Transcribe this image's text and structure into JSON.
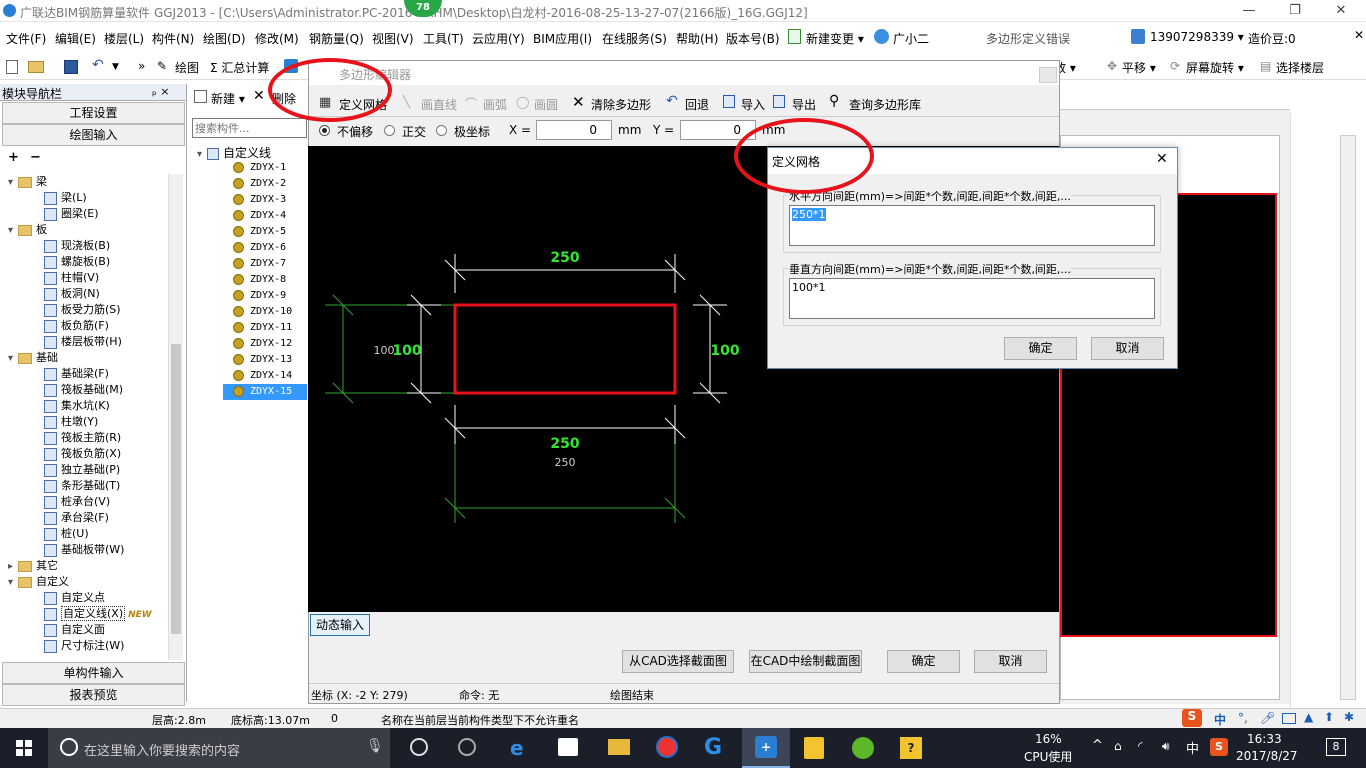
{
  "window": {
    "title": "广联达BIM钢筋算量软件 GGJ2013 - [C:\\Users\\Administrator.PC-2016    NRHM\\Desktop\\白龙村-2016-08-25-13-27-07(2166版)_16G.GGJ12]",
    "badge": "78",
    "minimize": "—",
    "restore": "❐",
    "close": "✕"
  },
  "menu": [
    "文件(F)",
    "编辑(E)",
    "楼层(L)",
    "构件(N)",
    "绘图(D)",
    "修改(M)",
    "钢筋量(Q)",
    "视图(V)",
    "工具(T)",
    "云应用(Y)",
    "BIM应用(I)",
    "在线服务(S)",
    "帮助(H)",
    "版本号(B)",
    "新建变更 ▾",
    "广小二"
  ],
  "menu_right": {
    "error": "多边形定义错误",
    "phone": "13907298339 ▾",
    "price": "造价豆:0"
  },
  "toolbar": {
    "draw": "绘图",
    "calc": "Σ 汇总计算",
    "zoom": "缩放 ▾",
    "pan": "平移 ▾",
    "rotate": "屏幕旋转 ▾",
    "floor": "选择楼层"
  },
  "nav": {
    "title": "模块导航栏",
    "pin": "ₚ ×",
    "eng_settings": "工程设置",
    "draw_input": "绘图输入",
    "single_input": "单构件输入",
    "report": "报表预览",
    "tree": [
      {
        "type": "folder",
        "label": "梁",
        "expanded": true
      },
      {
        "type": "leaf",
        "label": "梁(L)"
      },
      {
        "type": "leaf",
        "label": "圈梁(E)"
      },
      {
        "type": "folder",
        "label": "板",
        "expanded": true
      },
      {
        "type": "leaf",
        "label": "现浇板(B)"
      },
      {
        "type": "leaf",
        "label": "螺旋板(B)"
      },
      {
        "type": "leaf",
        "label": "柱帽(V)"
      },
      {
        "type": "leaf",
        "label": "板洞(N)"
      },
      {
        "type": "leaf",
        "label": "板受力筋(S)"
      },
      {
        "type": "leaf",
        "label": "板负筋(F)"
      },
      {
        "type": "leaf",
        "label": "楼层板带(H)"
      },
      {
        "type": "folder",
        "label": "基础",
        "expanded": true
      },
      {
        "type": "leaf",
        "label": "基础梁(F)"
      },
      {
        "type": "leaf",
        "label": "筏板基础(M)"
      },
      {
        "type": "leaf",
        "label": "集水坑(K)"
      },
      {
        "type": "leaf",
        "label": "柱墩(Y)"
      },
      {
        "type": "leaf",
        "label": "筏板主筋(R)"
      },
      {
        "type": "leaf",
        "label": "筏板负筋(X)"
      },
      {
        "type": "leaf",
        "label": "独立基础(P)"
      },
      {
        "type": "leaf",
        "label": "条形基础(T)"
      },
      {
        "type": "leaf",
        "label": "桩承台(V)"
      },
      {
        "type": "leaf",
        "label": "承台梁(F)"
      },
      {
        "type": "leaf",
        "label": "桩(U)"
      },
      {
        "type": "leaf",
        "label": "基础板带(W)"
      },
      {
        "type": "folder",
        "label": "其它",
        "expanded": false
      },
      {
        "type": "folder",
        "label": "自定义",
        "expanded": true
      },
      {
        "type": "leaf",
        "label": "自定义点"
      },
      {
        "type": "leaf",
        "label": "自定义线(X)",
        "selected": true,
        "tag": "NEW"
      },
      {
        "type": "leaf",
        "label": "自定义面"
      },
      {
        "type": "leaf",
        "label": "尺寸标注(W)"
      }
    ]
  },
  "list": {
    "new": "新建 ▾",
    "delete": "删除",
    "search_placeholder": "搜索构件...",
    "root": "自定义线",
    "items": [
      "ZDYX-1",
      "ZDYX-2",
      "ZDYX-3",
      "ZDYX-4",
      "ZDYX-5",
      "ZDYX-6",
      "ZDYX-7",
      "ZDYX-8",
      "ZDYX-9",
      "ZDYX-10",
      "ZDYX-11",
      "ZDYX-12",
      "ZDYX-13",
      "ZDYX-14",
      "ZDYX-15"
    ],
    "selected_index": 14
  },
  "editor": {
    "title": "多边形编辑器",
    "tools": {
      "define_grid": "定义网格",
      "line": "画直线",
      "arc": "画弧",
      "circle": "画圆",
      "clear": "清除多边形",
      "undo": "回退",
      "import": "导入",
      "export": "导出",
      "query": "查询多边形库"
    },
    "opts": {
      "no_offset": "不偏移",
      "ortho": "正交",
      "polar": "极坐标",
      "x_label": "X =",
      "x_val": "0",
      "unit1": "mm",
      "y_label": "Y =",
      "y_val": "0",
      "unit2": "mm"
    },
    "dims": {
      "top": "250",
      "left_white": "100",
      "left_green": "100",
      "right": "100",
      "bottom_green": "250",
      "bottom_white": "250"
    },
    "dynamic": "动态输入",
    "from_cad": "从CAD选择截面图",
    "in_cad": "在CAD中绘制截面图",
    "ok": "确定",
    "cancel": "取消",
    "status": {
      "coord": "坐标 (X: -2 Y: 279)",
      "cmd": "命令: 无",
      "msg": "绘图结束"
    }
  },
  "dialog": {
    "title": "定义网格",
    "h_label": "水平方向间距(mm)=>间距*个数,间距,间距*个数,间距,...",
    "h_value": "250*1",
    "v_label": "垂直方向间距(mm)=>间距*个数,间距,间距*个数,间距,...",
    "v_value": "100*1",
    "ok": "确定",
    "cancel": "取消"
  },
  "statusbar": {
    "floor_h": "层高:2.8m",
    "base_h": "底标高:13.07m",
    "num": "0",
    "msg": "名称在当前层当前构件类型下不允许重名"
  },
  "taskbar": {
    "search": "在这里输入你要搜索的内容",
    "cpu_pct": "16%",
    "cpu_label": "CPU使用",
    "ime": "中",
    "time": "16:33",
    "date": "2017/8/27",
    "notif": "8"
  },
  "ime_bar": {
    "lang": "中"
  },
  "colors": {
    "red_mark": "#e8121a",
    "canvas": "#000000",
    "dim_green": "#34e534",
    "taskbar": "#1b1f2a"
  }
}
